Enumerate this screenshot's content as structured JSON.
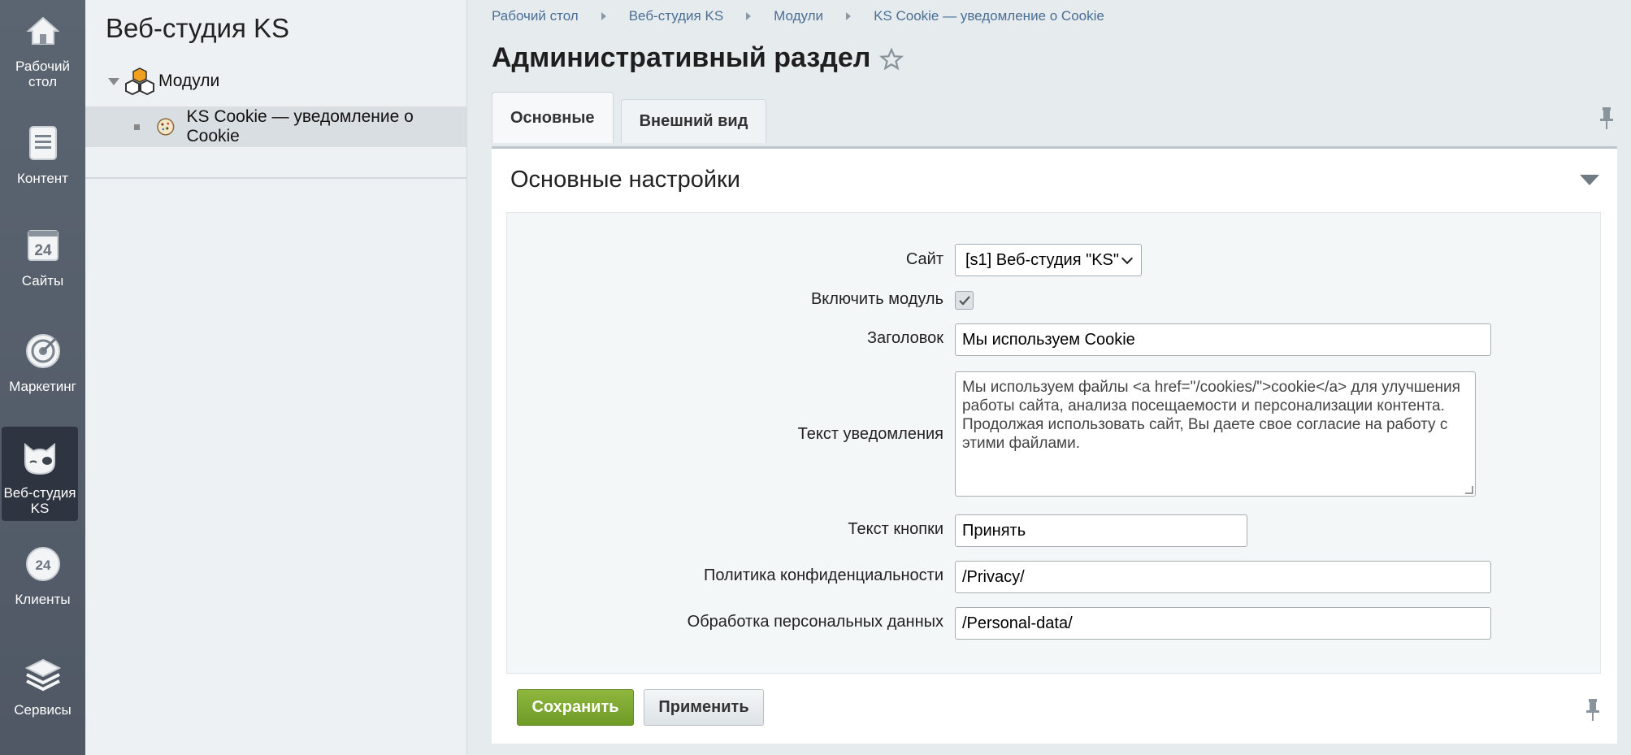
{
  "rail": {
    "items": [
      {
        "label": "Рабочий стол",
        "icon": "home-icon"
      },
      {
        "label": "Контент",
        "icon": "document-icon"
      },
      {
        "label": "Сайты",
        "icon": "calendar-24-icon"
      },
      {
        "label": "Маркетинг",
        "icon": "target-icon"
      },
      {
        "label": "Веб-студия KS",
        "icon": "cat-icon",
        "active": true
      },
      {
        "label": "Клиенты",
        "icon": "clients-24-icon"
      },
      {
        "label": "Сервисы",
        "icon": "layers-icon"
      }
    ]
  },
  "tree": {
    "title": "Веб-студия KS",
    "modules_label": "Модули",
    "cookie_label": "KS Cookie — уведомление о Cookie"
  },
  "breadcrumb": [
    "Рабочий стол",
    "Веб-студия KS",
    "Модули",
    "KS Cookie — уведомление о Cookie"
  ],
  "page": {
    "title": "Административный раздел"
  },
  "tabs": [
    {
      "label": "Основные",
      "active": true
    },
    {
      "label": "Внешний вид",
      "active": false
    }
  ],
  "section": {
    "title": "Основные настройки"
  },
  "form": {
    "site_label": "Сайт",
    "site_value": "[s1] Веб-студия \"KS\"",
    "enable_label": "Включить модуль",
    "enable_checked": true,
    "heading_label": "Заголовок",
    "heading_value": "Мы используем Cookie",
    "notice_label": "Текст уведомления",
    "notice_value": "Мы используем файлы <a href=\"/cookies/\">cookie</a> для улучшения работы сайта, анализа посещаемости и персонализации контента. Продолжая использовать сайт, Вы даете свое согласие на работу с этими файлами.",
    "button_text_label": "Текст кнопки",
    "button_text_value": "Принять",
    "privacy_label": "Политика конфиденциальности",
    "privacy_value": "/Privacy/",
    "personal_label": "Обработка персональных данных",
    "personal_value": "/Personal-data/"
  },
  "buttons": {
    "save": "Сохранить",
    "apply": "Применить"
  },
  "colors": {
    "rail": "#535c68",
    "save": "#7aa52f",
    "link": "#4b6e94"
  }
}
